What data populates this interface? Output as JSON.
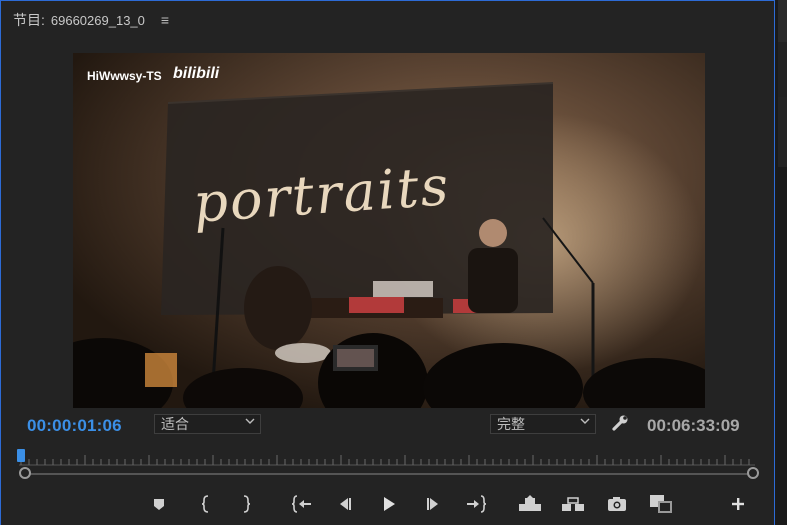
{
  "panel": {
    "title_prefix": "节目:",
    "sequence_name": "69660269_13_0",
    "menu_icon": "hamburger-menu-icon"
  },
  "viewer": {
    "watermark_user": "HiWwwsy-TS",
    "watermark_brand": "bilibili",
    "banner_text": "portraits"
  },
  "timecode": {
    "current": "00:00:01:06",
    "total": "00:06:33:09"
  },
  "fit_select": {
    "value": "适合"
  },
  "quality_select": {
    "value": "完整"
  },
  "icons": {
    "settings": "wrench-icon",
    "transport": [
      "add-marker-icon",
      "mark-in-icon",
      "mark-out-icon",
      "go-to-in-icon",
      "step-back-icon",
      "play-icon",
      "step-forward-icon",
      "go-to-out-icon",
      "lift-icon",
      "extract-icon",
      "export-frame-icon",
      "comparison-view-icon",
      "add-button-icon"
    ]
  },
  "colors": {
    "accent": "#3b8fe6",
    "panel_bg": "#232323",
    "panel_border": "#2d6bd6"
  }
}
